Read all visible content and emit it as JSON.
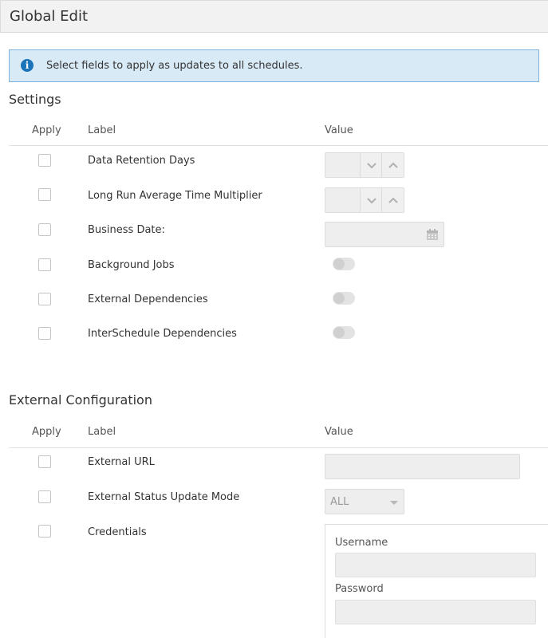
{
  "header": {
    "title": "Global Edit"
  },
  "info": {
    "icon": "info-icon",
    "message": "Select fields to apply as updates to all schedules."
  },
  "settings": {
    "title": "Settings",
    "columns": {
      "apply": "Apply",
      "label": "Label",
      "value": "Value"
    },
    "rows": [
      {
        "label": "Data Retention Days",
        "control": "spinner",
        "value": ""
      },
      {
        "label": "Long Run Average Time Multiplier",
        "control": "spinner",
        "value": ""
      },
      {
        "label": "Business Date:",
        "control": "date",
        "value": ""
      },
      {
        "label": "Background Jobs",
        "control": "toggle",
        "value": "off"
      },
      {
        "label": "External Dependencies",
        "control": "toggle",
        "value": "off"
      },
      {
        "label": "InterSchedule Dependencies",
        "control": "toggle",
        "value": "off"
      }
    ]
  },
  "external": {
    "title": "External Configuration",
    "columns": {
      "apply": "Apply",
      "label": "Label",
      "value": "Value"
    },
    "rows": [
      {
        "label": "External URL",
        "control": "text",
        "value": ""
      },
      {
        "label": "External Status Update Mode",
        "control": "select",
        "value": "ALL"
      },
      {
        "label": "Credentials",
        "control": "credentials"
      }
    ],
    "credentials": {
      "username_label": "Username",
      "username_value": "",
      "password_label": "Password",
      "password_value": ""
    }
  },
  "colors": {
    "accent": "#1b74ba",
    "info_bg": "#d9eaf7",
    "info_border": "#7fb2dc",
    "disabled_bg": "#eeeeee"
  }
}
